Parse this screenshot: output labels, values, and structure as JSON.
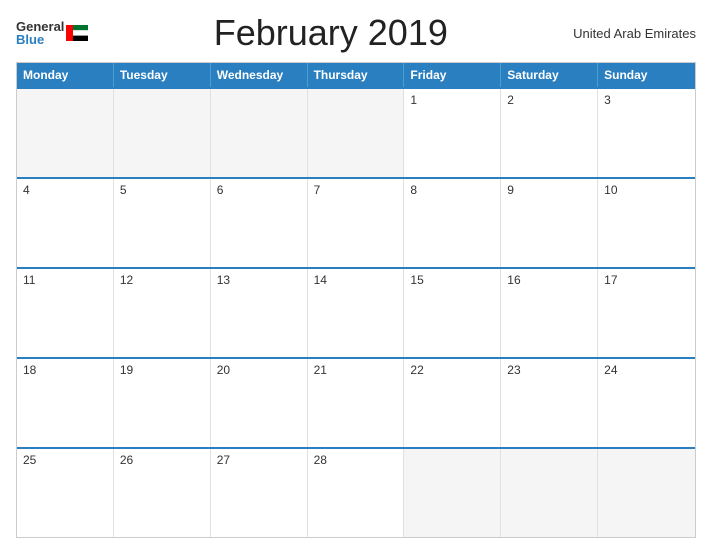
{
  "header": {
    "title": "February 2019",
    "country": "United Arab Emirates",
    "logo_general": "General",
    "logo_blue": "Blue"
  },
  "calendar": {
    "days_of_week": [
      "Monday",
      "Tuesday",
      "Wednesday",
      "Thursday",
      "Friday",
      "Saturday",
      "Sunday"
    ],
    "weeks": [
      [
        {
          "day": "",
          "empty": true
        },
        {
          "day": "",
          "empty": true
        },
        {
          "day": "",
          "empty": true
        },
        {
          "day": "",
          "empty": true
        },
        {
          "day": "1",
          "empty": false
        },
        {
          "day": "2",
          "empty": false
        },
        {
          "day": "3",
          "empty": false
        }
      ],
      [
        {
          "day": "4",
          "empty": false
        },
        {
          "day": "5",
          "empty": false
        },
        {
          "day": "6",
          "empty": false
        },
        {
          "day": "7",
          "empty": false
        },
        {
          "day": "8",
          "empty": false
        },
        {
          "day": "9",
          "empty": false
        },
        {
          "day": "10",
          "empty": false
        }
      ],
      [
        {
          "day": "11",
          "empty": false
        },
        {
          "day": "12",
          "empty": false
        },
        {
          "day": "13",
          "empty": false
        },
        {
          "day": "14",
          "empty": false
        },
        {
          "day": "15",
          "empty": false
        },
        {
          "day": "16",
          "empty": false
        },
        {
          "day": "17",
          "empty": false
        }
      ],
      [
        {
          "day": "18",
          "empty": false
        },
        {
          "day": "19",
          "empty": false
        },
        {
          "day": "20",
          "empty": false
        },
        {
          "day": "21",
          "empty": false
        },
        {
          "day": "22",
          "empty": false
        },
        {
          "day": "23",
          "empty": false
        },
        {
          "day": "24",
          "empty": false
        }
      ],
      [
        {
          "day": "25",
          "empty": false
        },
        {
          "day": "26",
          "empty": false
        },
        {
          "day": "27",
          "empty": false
        },
        {
          "day": "28",
          "empty": false
        },
        {
          "day": "",
          "empty": true
        },
        {
          "day": "",
          "empty": true
        },
        {
          "day": "",
          "empty": true
        }
      ]
    ]
  }
}
